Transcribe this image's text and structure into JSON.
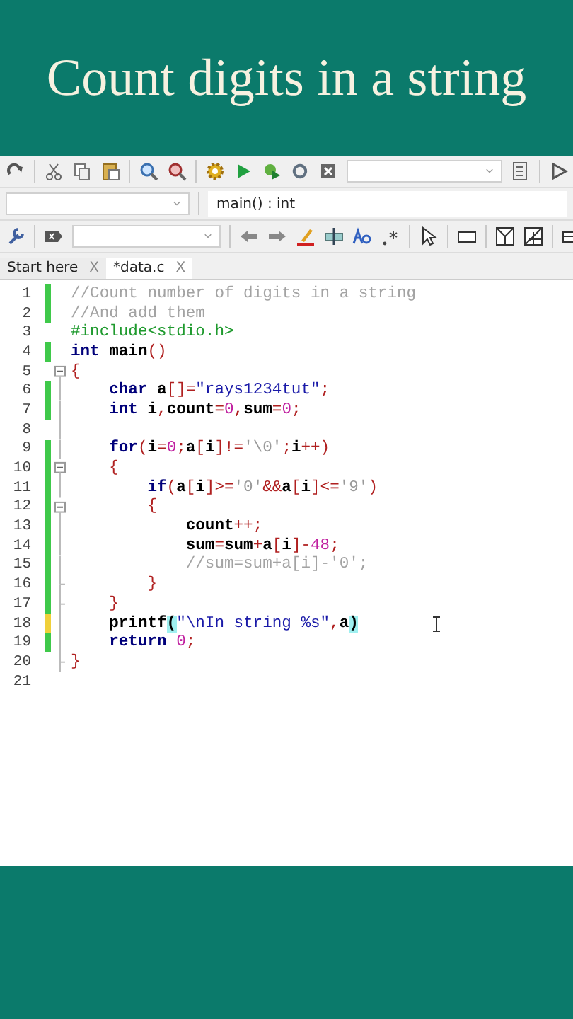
{
  "title": "Count digits in a string",
  "function_field": {
    "value": "main() : int"
  },
  "tabs": [
    {
      "label": "Start here",
      "close": "X",
      "selected": false
    },
    {
      "label": "*data.c",
      "close": "X",
      "selected": true
    }
  ],
  "lines": [
    {
      "number": "1",
      "color": "#3fc94a",
      "kind": "plain",
      "tokens": [
        {
          "kind": "comment",
          "text": "//Count number of digits in a string"
        }
      ]
    },
    {
      "number": "2",
      "color": "#3fc94a",
      "kind": "plain",
      "tokens": [
        {
          "kind": "comment",
          "text": "//And add them"
        }
      ]
    },
    {
      "number": "3",
      "kind": "plain",
      "tokens": [
        {
          "kind": "preproc",
          "text": "#include<stdio.h>"
        }
      ]
    },
    {
      "number": "4",
      "color": "#3fc94a",
      "kind": "plain",
      "tokens": [
        {
          "kind": "keyword",
          "text": "int"
        },
        {
          "kind": "ident",
          "text": " main"
        },
        {
          "kind": "op",
          "text": "()"
        }
      ]
    },
    {
      "number": "5",
      "kind": "start",
      "tokens": [
        {
          "kind": "op",
          "text": "{"
        }
      ]
    },
    {
      "number": "6",
      "color": "#3fc94a",
      "kind": "body",
      "tokens": [
        {
          "kind": "keyword",
          "text": "    char"
        },
        {
          "kind": "ident",
          "text": " a"
        },
        {
          "kind": "op",
          "text": "[]="
        },
        {
          "kind": "string",
          "text": "\"rays1234tut\""
        },
        {
          "kind": "op",
          "text": ";"
        }
      ]
    },
    {
      "number": "7",
      "color": "#3fc94a",
      "kind": "body",
      "tokens": [
        {
          "kind": "keyword",
          "text": "    int"
        },
        {
          "kind": "ident",
          "text": " i"
        },
        {
          "kind": "op",
          "text": ","
        },
        {
          "kind": "ident",
          "text": "count"
        },
        {
          "kind": "op",
          "text": "="
        },
        {
          "kind": "number",
          "text": "0"
        },
        {
          "kind": "op",
          "text": ","
        },
        {
          "kind": "ident",
          "text": "sum"
        },
        {
          "kind": "op",
          "text": "="
        },
        {
          "kind": "number",
          "text": "0"
        },
        {
          "kind": "op",
          "text": ";"
        }
      ]
    },
    {
      "number": "8",
      "kind": "body"
    },
    {
      "number": "9",
      "color": "#3fc94a",
      "kind": "body",
      "tokens": [
        {
          "kind": "keyword",
          "text": "    for"
        },
        {
          "kind": "op",
          "text": "("
        },
        {
          "kind": "ident",
          "text": "i"
        },
        {
          "kind": "op",
          "text": "="
        },
        {
          "kind": "number",
          "text": "0"
        },
        {
          "kind": "op",
          "text": ";"
        },
        {
          "kind": "ident",
          "text": "a"
        },
        {
          "kind": "op",
          "text": "["
        },
        {
          "kind": "ident",
          "text": "i"
        },
        {
          "kind": "op",
          "text": "]!="
        },
        {
          "kind": "char",
          "text": "'\\0'"
        },
        {
          "kind": "op",
          "text": ";"
        },
        {
          "kind": "ident",
          "text": "i"
        },
        {
          "kind": "op",
          "text": "++)"
        }
      ]
    },
    {
      "number": "10",
      "color": "#3fc94a",
      "kind": "start",
      "tokens": [
        {
          "kind": "op",
          "text": "    {"
        }
      ]
    },
    {
      "number": "11",
      "color": "#3fc94a",
      "kind": "body",
      "tokens": [
        {
          "kind": "keyword",
          "text": "        if"
        },
        {
          "kind": "op",
          "text": "("
        },
        {
          "kind": "ident",
          "text": "a"
        },
        {
          "kind": "op",
          "text": "["
        },
        {
          "kind": "ident",
          "text": "i"
        },
        {
          "kind": "op",
          "text": "]>="
        },
        {
          "kind": "char",
          "text": "'0'"
        },
        {
          "kind": "op",
          "text": "&&"
        },
        {
          "kind": "ident",
          "text": "a"
        },
        {
          "kind": "op",
          "text": "["
        },
        {
          "kind": "ident",
          "text": "i"
        },
        {
          "kind": "op",
          "text": "]<="
        },
        {
          "kind": "char",
          "text": "'9'"
        },
        {
          "kind": "op",
          "text": ")"
        }
      ]
    },
    {
      "number": "12",
      "color": "#3fc94a",
      "kind": "start",
      "tokens": [
        {
          "kind": "op",
          "text": "        {"
        }
      ]
    },
    {
      "number": "13",
      "color": "#3fc94a",
      "kind": "body",
      "tokens": [
        {
          "kind": "ident",
          "text": "            count"
        },
        {
          "kind": "op",
          "text": "++;"
        }
      ]
    },
    {
      "number": "14",
      "color": "#3fc94a",
      "kind": "body",
      "tokens": [
        {
          "kind": "ident",
          "text": "            sum"
        },
        {
          "kind": "op",
          "text": "="
        },
        {
          "kind": "ident",
          "text": "sum"
        },
        {
          "kind": "op",
          "text": "+"
        },
        {
          "kind": "ident",
          "text": "a"
        },
        {
          "kind": "op",
          "text": "["
        },
        {
          "kind": "ident",
          "text": "i"
        },
        {
          "kind": "op",
          "text": "]-"
        },
        {
          "kind": "number",
          "text": "48"
        },
        {
          "kind": "op",
          "text": ";"
        }
      ]
    },
    {
      "number": "15",
      "color": "#3fc94a",
      "kind": "body",
      "tokens": [
        {
          "kind": "comment",
          "text": "            //sum=sum+a[i]-'0';"
        }
      ]
    },
    {
      "number": "16",
      "color": "#3fc94a",
      "kind": "end",
      "tokens": [
        {
          "kind": "op",
          "text": "        }"
        }
      ]
    },
    {
      "number": "17",
      "color": "#3fc94a",
      "kind": "end",
      "tokens": [
        {
          "kind": "op",
          "text": "    }"
        }
      ]
    },
    {
      "number": "18",
      "color": "#f0d03a",
      "kind": "body",
      "tokens": [
        {
          "kind": "ident",
          "text": "    printf"
        },
        {
          "kind": "brace",
          "text": "("
        },
        {
          "kind": "string",
          "text": "\"\\nIn string %s\""
        },
        {
          "kind": "op",
          "text": ","
        },
        {
          "kind": "ident",
          "text": "a"
        },
        {
          "kind": "brace",
          "text": ")"
        }
      ]
    },
    {
      "number": "19",
      "color": "#3fc94a",
      "kind": "body",
      "tokens": [
        {
          "kind": "keyword",
          "text": "    return"
        },
        {
          "kind": "number",
          "text": " 0"
        },
        {
          "kind": "op",
          "text": ";"
        }
      ]
    },
    {
      "number": "20",
      "kind": "end",
      "tokens": [
        {
          "kind": "op",
          "text": "}"
        }
      ]
    },
    {
      "number": "21",
      "kind": "plain"
    }
  ]
}
